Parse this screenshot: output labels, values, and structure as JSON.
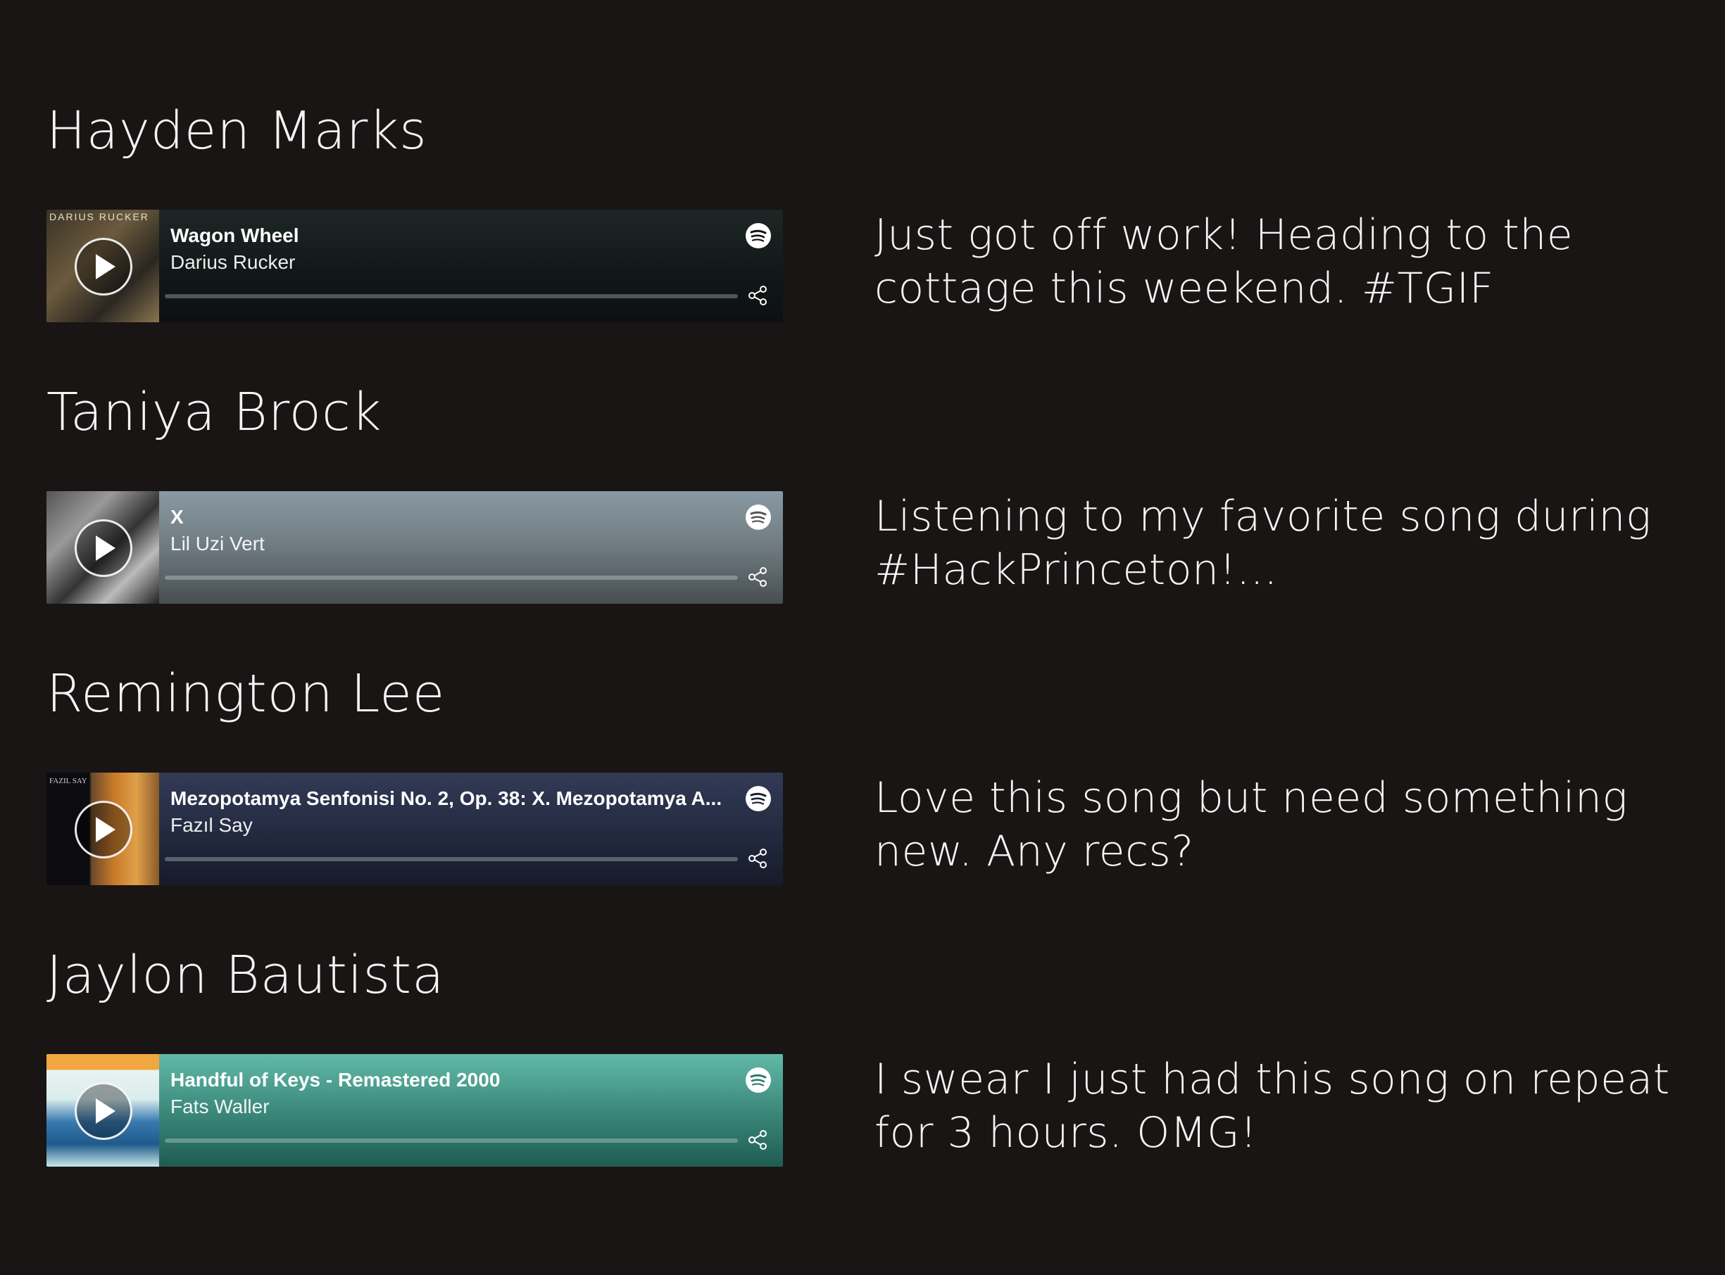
{
  "feed": {
    "posts": [
      {
        "user": "Hayden Marks",
        "track": {
          "title": "Wagon Wheel",
          "artist": "Darius Rucker",
          "cover_text": "DARIUS RUCKER"
        },
        "message": "Just got off work! Heading to the cottage this weekend. #TGIF"
      },
      {
        "user": "Taniya Brock",
        "track": {
          "title": "X",
          "artist": "Lil Uzi Vert",
          "cover_text": ""
        },
        "message": "Listening to my favorite song during #HackPrinceton!..."
      },
      {
        "user": "Remington Lee",
        "track": {
          "title": "Mezopotamya Senfonisi No. 2, Op. 38: X. Mezopotamya A...",
          "artist": "Fazıl Say",
          "cover_text": "FAZIL SAY"
        },
        "message": "Love this song but need something new. Any recs?"
      },
      {
        "user": "Jaylon Bautista",
        "track": {
          "title": "Handful of Keys - Remastered 2000",
          "artist": "Fats Waller",
          "cover_text": ""
        },
        "message": "I swear I just had this song on repeat for 3 hours. OMG!"
      }
    ]
  },
  "icons": {
    "play": "play-icon",
    "brand": "spotify-icon",
    "share": "share-icon"
  },
  "colors": {
    "background": "#181514",
    "text": "#f4f4f4"
  }
}
